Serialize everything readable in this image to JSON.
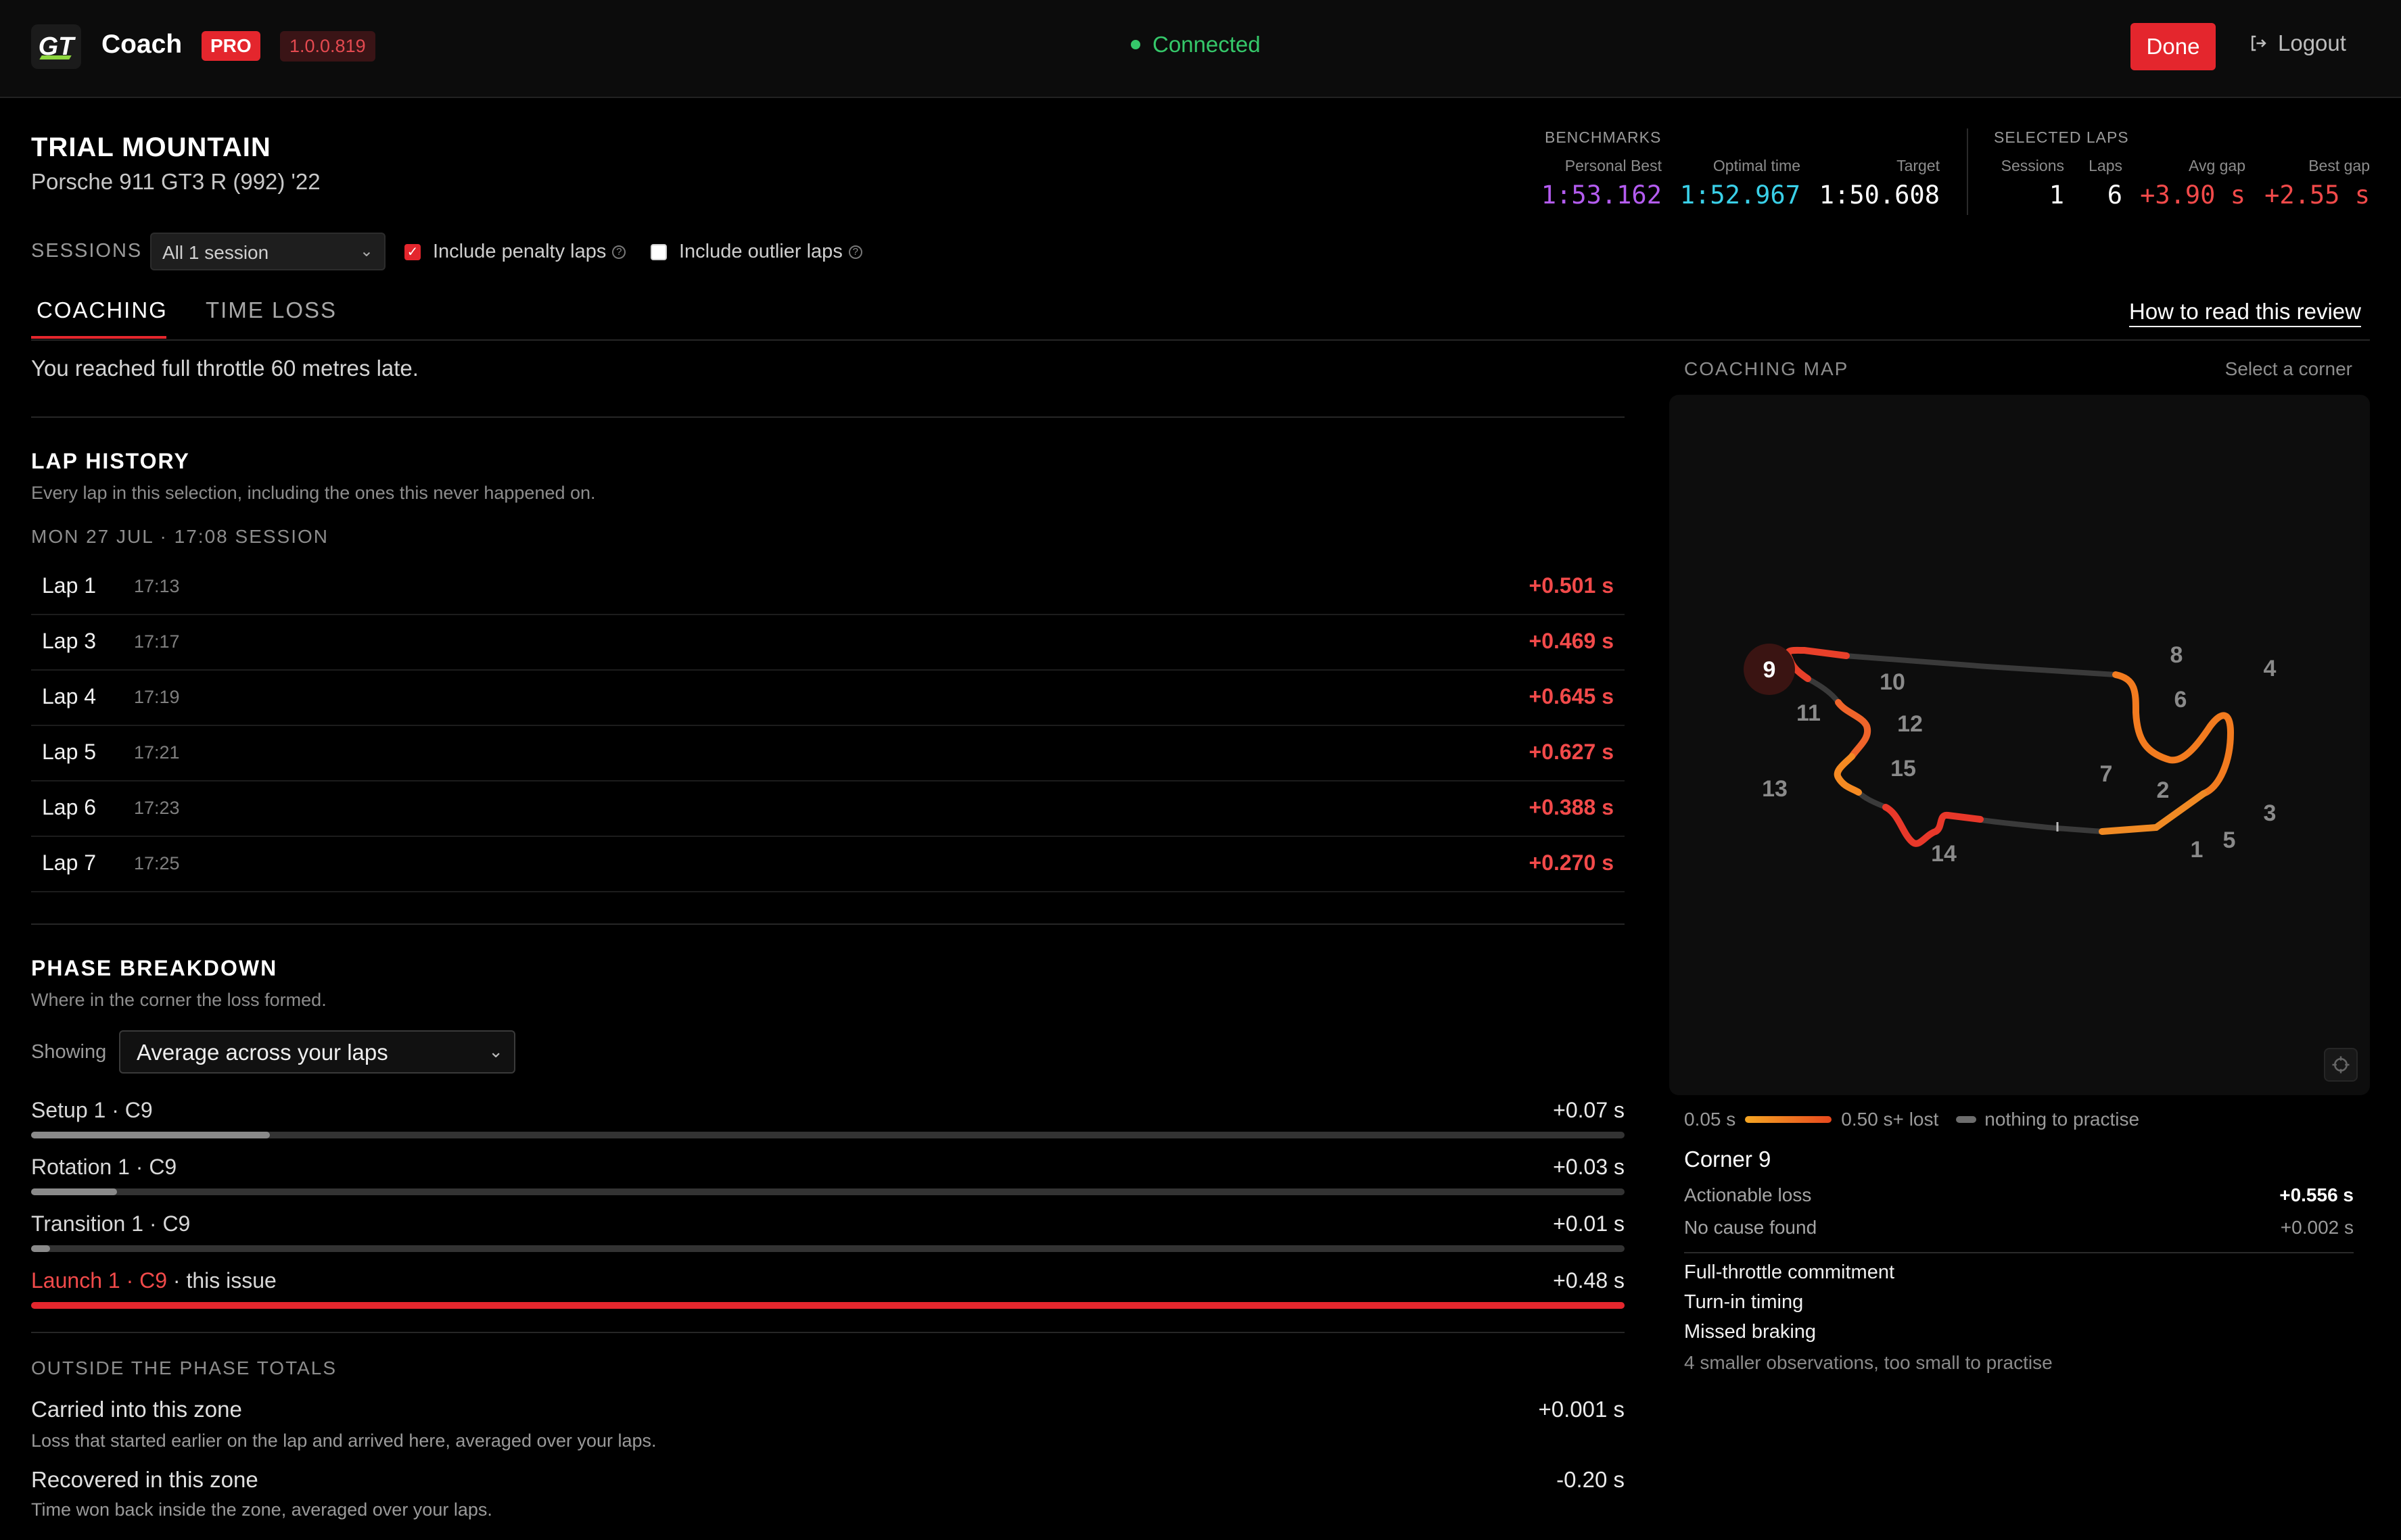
{
  "app": {
    "logo_text": "GT",
    "name": "Coach",
    "badge": "PRO",
    "version": "1.0.0.819",
    "status": "Connected",
    "done_label": "Done",
    "logout_label": "Logout"
  },
  "header": {
    "track": "TRIAL MOUNTAIN",
    "car": "Porsche 911 GT3 R (992) '22"
  },
  "benchmarks": {
    "title": "BENCHMARKS",
    "personal_best_label": "Personal Best",
    "personal_best": "1:53.162",
    "optimal_label": "Optimal time",
    "optimal": "1:52.967",
    "target_label": "Target",
    "target": "1:50.608"
  },
  "selected_laps": {
    "title": "SELECTED LAPS",
    "sessions_label": "Sessions",
    "sessions": "1",
    "laps_label": "Laps",
    "laps": "6",
    "avg_gap_label": "Avg gap",
    "avg_gap": "+3.90 s",
    "best_gap_label": "Best gap",
    "best_gap": "+2.55 s"
  },
  "filters": {
    "sessions_label": "SESSIONS",
    "sessions_value": "All 1 session",
    "penalty_label": "Include penalty laps",
    "penalty_checked": true,
    "outlier_label": "Include outlier laps",
    "outlier_checked": false
  },
  "tabs": {
    "coaching": "COACHING",
    "time_loss": "TIME LOSS",
    "how_to": "How to read this review"
  },
  "summary": "You reached full throttle 60 metres late.",
  "lap_history": {
    "title": "LAP HISTORY",
    "subtitle": "Every lap in this selection, including the ones this never happened on.",
    "session_heading": "MON 27 JUL · 17:08 SESSION",
    "laps": [
      {
        "name": "Lap 1",
        "time": "17:13",
        "gap": "+0.501 s"
      },
      {
        "name": "Lap 3",
        "time": "17:17",
        "gap": "+0.469 s"
      },
      {
        "name": "Lap 4",
        "time": "17:19",
        "gap": "+0.645 s"
      },
      {
        "name": "Lap 5",
        "time": "17:21",
        "gap": "+0.627 s"
      },
      {
        "name": "Lap 6",
        "time": "17:23",
        "gap": "+0.388 s"
      },
      {
        "name": "Lap 7",
        "time": "17:25",
        "gap": "+0.270 s"
      }
    ]
  },
  "phase_breakdown": {
    "title": "PHASE BREAKDOWN",
    "subtitle": "Where in the corner the loss formed.",
    "showing_label": "Showing",
    "showing_value": "Average across your laps",
    "phases": [
      {
        "label": "Setup 1 · C9",
        "value": "+0.07 s",
        "fraction": 0.15
      },
      {
        "label": "Rotation 1 · C9",
        "value": "+0.03 s",
        "fraction": 0.054
      },
      {
        "label": "Transition 1 · C9",
        "value": "+0.01 s",
        "fraction": 0.012
      },
      {
        "label": "Launch 1 · C9",
        "suffix": " · this issue",
        "value": "+0.48 s",
        "fraction": 1.0
      }
    ]
  },
  "outside": {
    "heading": "OUTSIDE THE PHASE TOTALS",
    "carried_title": "Carried into this zone",
    "carried_sub": "Loss that started earlier on the lap and arrived here, averaged over your laps.",
    "carried_value": "+0.001 s",
    "recovered_title": "Recovered in this zone",
    "recovered_sub": "Time won back inside the zone, averaged over your laps.",
    "recovered_value": "-0.20 s"
  },
  "coaching_map": {
    "title": "COACHING MAP",
    "select_hint": "Select a corner",
    "corners": [
      "1",
      "2",
      "3",
      "4",
      "5",
      "6",
      "7",
      "8",
      "9",
      "10",
      "11",
      "12",
      "13",
      "14",
      "15"
    ],
    "selected_corner": "9",
    "legend_min": "0.05 s",
    "legend_max": "0.50 s+ lost",
    "legend_none": "nothing to practise"
  },
  "corner_detail": {
    "title": "Corner 9",
    "actionable_label": "Actionable loss",
    "actionable_value": "+0.556 s",
    "nocause_label": "No cause found",
    "nocause_value": "+0.002 s",
    "causes": [
      "Full-throttle commitment",
      "Turn-in timing",
      "Missed braking"
    ],
    "smaller_note": "4 smaller observations, too small to practise"
  },
  "colors": {
    "accent": "#e4262d",
    "connected": "#35c86a",
    "personal_best": "#b45cf0",
    "optimal": "#3ad0e8",
    "loss": "#f24a4a"
  }
}
